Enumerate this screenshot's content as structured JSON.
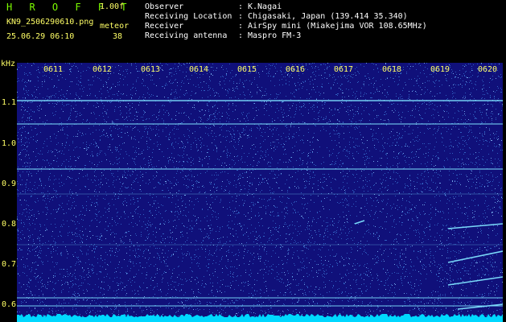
{
  "header": {
    "app_title": "H R O F F T",
    "version": "1.00f",
    "file_name": "KN9_2506290610.png",
    "meteor_label": "meteor",
    "date_time": "25.06.29 06:10",
    "meteor_count": "38"
  },
  "info": [
    {
      "key": "Observer",
      "sep": ":",
      "value": "K.Nagai"
    },
    {
      "key": "Receiving Location",
      "sep": ":",
      "value": "Chigasaki, Japan (139.414 35.340)"
    },
    {
      "key": "Receiver",
      "sep": ":",
      "value": "AirSpy mini (Miakejima VOR 108.65MHz)"
    },
    {
      "key": "Receiving antenna",
      "sep": ":",
      "value": "Maspro FM-3"
    }
  ],
  "axis": {
    "y_unit": "kHz",
    "y_ticks": [
      "1.1",
      "1.0",
      "0.9",
      "0.8",
      "0.7",
      "0.6"
    ],
    "time_ticks": [
      "0611",
      "0612",
      "0613",
      "0614",
      "0615",
      "0616",
      "0617",
      "0618",
      "0619",
      "0620"
    ]
  },
  "colors": {
    "background": "#000000",
    "plot_background": "#10107a",
    "noise": "#3a7ad8",
    "trace": "#7fe3ff",
    "tick_label": "#FFFF66",
    "title": "#7CFC00",
    "baseline": "#00d8ff"
  }
}
